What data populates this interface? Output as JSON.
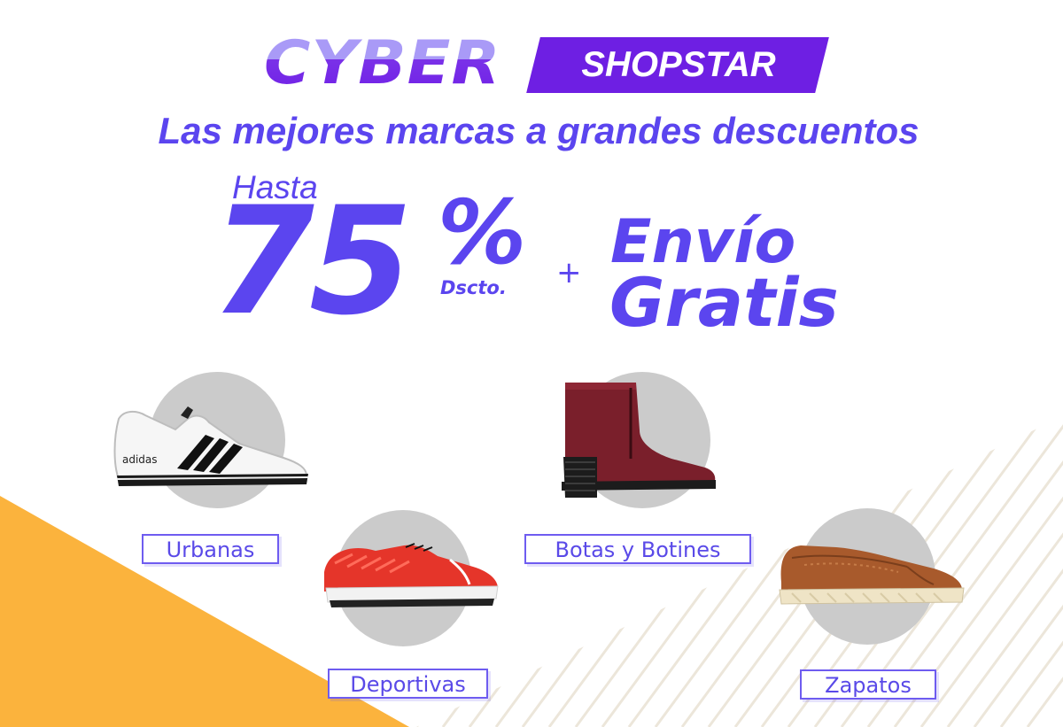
{
  "brand": {
    "cyber": "CYBER",
    "shopstar": "SHOPSTAR"
  },
  "tagline": "Las mejores marcas a grandes descuentos",
  "offer": {
    "prefix": "Hasta",
    "discount": "75",
    "percent": "%",
    "discount_label": "Dscto.",
    "plus": "+",
    "shipping_line1": "Envío",
    "shipping_line2": "Gratis"
  },
  "categories": [
    {
      "label": "Urbanas",
      "product_brand": "adidas"
    },
    {
      "label": "Deportivas"
    },
    {
      "label": "Botas y Botines"
    },
    {
      "label": "Zapatos"
    }
  ],
  "colors": {
    "primary": "#5b45ef",
    "brand_box": "#6e1fe3",
    "accent_yellow": "#fbb33d",
    "circle_gray": "#cbcbcb"
  }
}
